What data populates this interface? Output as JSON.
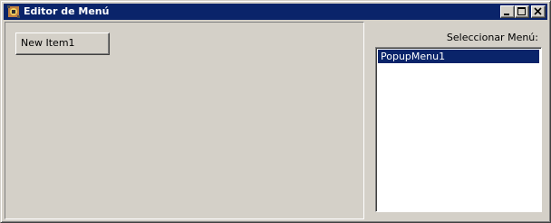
{
  "window": {
    "title": "Editor de Menú",
    "title_bar_color": "#0a246a",
    "icons": {
      "app": "app-icon",
      "minimize": "minimize-icon",
      "maximize": "maximize-icon",
      "close": "close-icon"
    }
  },
  "editor": {
    "menu_item_label": "New Item1"
  },
  "menu_selector": {
    "label": "Seleccionar Menú:",
    "items": [
      {
        "label": "PopupMenu1",
        "selected": true
      }
    ]
  }
}
